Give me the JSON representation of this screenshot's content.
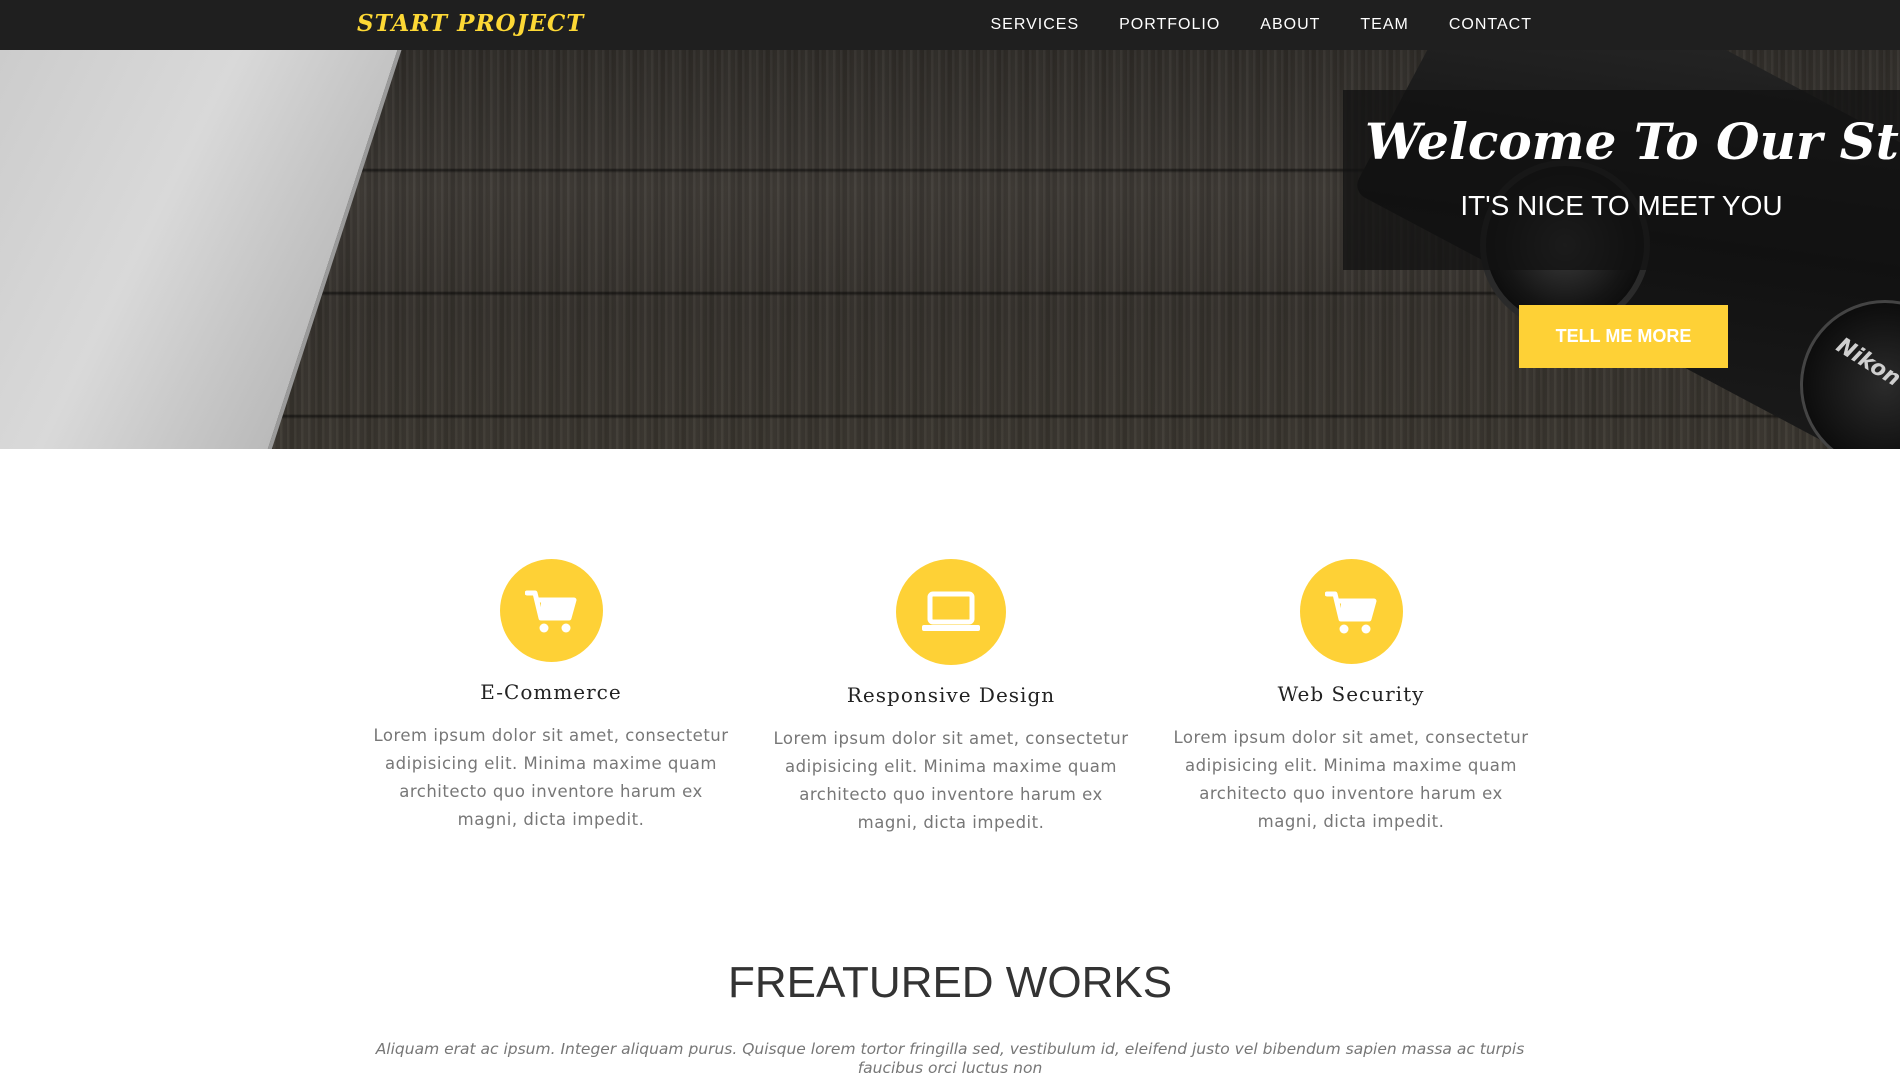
{
  "nav": {
    "logo": "START PROJECT",
    "items": [
      {
        "label": "SERVICES"
      },
      {
        "label": "PORTFOLIO"
      },
      {
        "label": "ABOUT"
      },
      {
        "label": "TEAM"
      },
      {
        "label": "CONTACT"
      }
    ]
  },
  "hero": {
    "title": "Welcome To Our Studio!",
    "subtitle": "IT'S NICE TO MEET YOU",
    "button_label": "TELL ME MORE",
    "lens_cap_text": "Nikon"
  },
  "services": [
    {
      "icon": "shopping-cart-icon",
      "title": "E-Commerce",
      "text": "Lorem ipsum dolor sit amet, consectetur adipisicing elit. Minima maxime quam architecto quo inventore harum ex magni, dicta impedit."
    },
    {
      "icon": "laptop-icon",
      "title": "Responsive Design",
      "text": "Lorem ipsum dolor sit amet, consectetur adipisicing elit. Minima maxime quam architecto quo inventore harum ex magni, dicta impedit."
    },
    {
      "icon": "shopping-cart-icon",
      "title": "Web Security",
      "text": "Lorem ipsum dolor sit amet, consectetur adipisicing elit. Minima maxime quam architecto quo inventore harum ex magni, dicta impedit."
    }
  ],
  "featured": {
    "title": "FREATURED WORKS",
    "text": "Aliquam erat ac ipsum. Integer aliquam purus. Quisque lorem tortor fringilla sed, vestibulum id, eleifend justo vel bibendum sapien massa ac turpis faucibus orci luctus non"
  },
  "colors": {
    "accent": "#fed136",
    "nav_bg": "#1f1f1f"
  }
}
